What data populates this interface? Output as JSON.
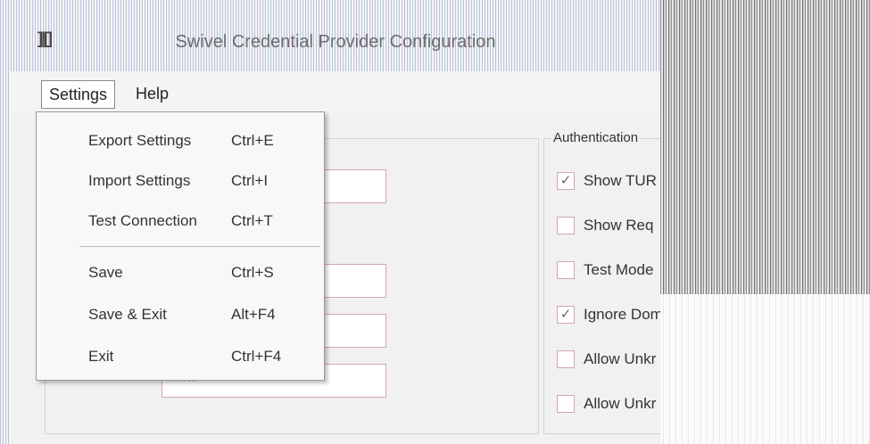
{
  "window": {
    "title": "Swivel Credential Provider Configuration"
  },
  "menubar": {
    "items": [
      "Settings",
      "Help"
    ]
  },
  "settings_menu": {
    "items": [
      {
        "label": "Export Settings",
        "shortcut": "Ctrl+E"
      },
      {
        "label": "Import Settings",
        "shortcut": "Ctrl+I"
      },
      {
        "label": "Test Connection",
        "shortcut": "Ctrl+T"
      },
      {
        "label": "Save",
        "shortcut": "Ctrl+S"
      },
      {
        "label": "Save & Exit",
        "shortcut": "Alt+F4"
      },
      {
        "label": "Exit",
        "shortcut": "Ctrl+F4"
      }
    ]
  },
  "left_panel": {
    "password_value": "••••••"
  },
  "auth_group": {
    "title": "Authentication",
    "checkboxes": [
      {
        "label": "Show TUR",
        "checked": true
      },
      {
        "label": "Show Req",
        "checked": false
      },
      {
        "label": "Test Mode",
        "checked": false
      },
      {
        "label": "Ignore Dom",
        "checked": true
      },
      {
        "label": "Allow Unkr",
        "checked": false
      },
      {
        "label": "Allow Unkr",
        "checked": false
      }
    ]
  },
  "colors": {
    "stripe_accent": "#c9b8e8",
    "field_border": "#d6a8a8"
  },
  "icons": {
    "app": "swivel-app-icon",
    "check": "checkmark-icon"
  }
}
